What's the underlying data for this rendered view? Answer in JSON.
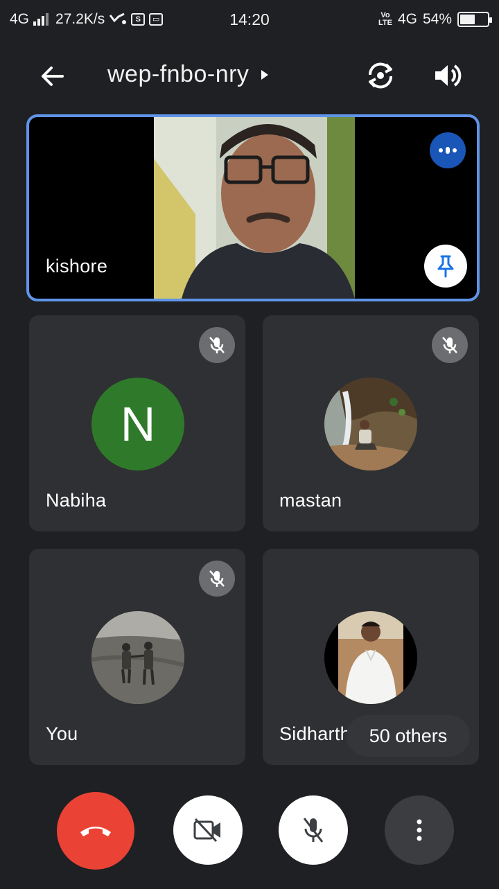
{
  "status_bar": {
    "network_left": "4G",
    "speed": "27.2K/s",
    "time": "14:20",
    "volte": "VoLTE",
    "network_right": "4G",
    "battery": "54%",
    "battery_level": 0.54
  },
  "meeting": {
    "code": "wep-fnbo-nry"
  },
  "participants": {
    "main": {
      "name": "kishore"
    },
    "tiles": [
      {
        "name": "Nabiha",
        "initial": "N",
        "muted": true
      },
      {
        "name": "mastan",
        "muted": true
      },
      {
        "name": "You",
        "muted": true
      },
      {
        "name": "Sidharth",
        "muted": false
      }
    ]
  },
  "others_chip": "50 others",
  "colors": {
    "background": "#1f2023",
    "tile": "#2f3033",
    "active_border": "#5f94e8",
    "end_call": "#ea4335",
    "avatar_green": "#2f7a2a",
    "speaking_blue": "#1a56b8"
  },
  "controls": {
    "end_call": "phone-hangup-icon",
    "camera": "camera-off-icon",
    "mic": "mic-off-icon",
    "more": "more-vert-icon"
  }
}
